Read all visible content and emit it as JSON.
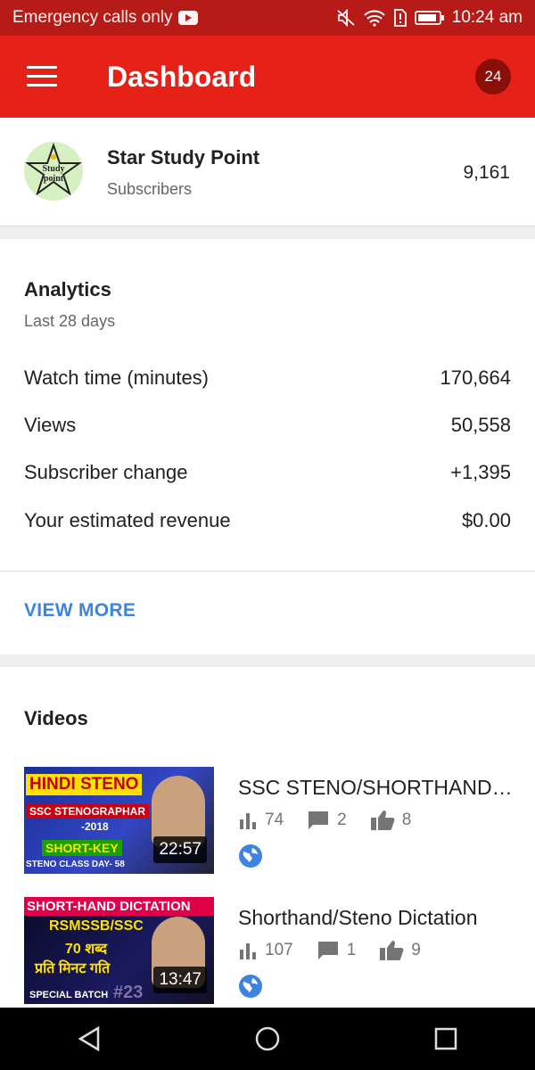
{
  "status_bar": {
    "carrier": "Emergency calls only",
    "time": "10:24 am"
  },
  "app_bar": {
    "title": "Dashboard",
    "notification_count": "24"
  },
  "channel": {
    "name": "Star Study Point",
    "avatar_text_1": "Study",
    "avatar_text_2": "point",
    "subscribers_label": "Subscribers",
    "subscribers_count": "9,161"
  },
  "analytics": {
    "title": "Analytics",
    "period": "Last 28 days",
    "metrics": [
      {
        "label": "Watch time (minutes)",
        "value": "170,664"
      },
      {
        "label": "Views",
        "value": "50,558"
      },
      {
        "label": "Subscriber change",
        "value": "+1,395"
      },
      {
        "label": "Your estimated revenue",
        "value": "$0.00"
      }
    ],
    "view_more": "VIEW MORE"
  },
  "videos": {
    "title": "Videos",
    "items": [
      {
        "title": "SSC STENO/SHORTHAND CLASS",
        "duration": "22:57",
        "views": "74",
        "comments": "2",
        "likes": "8",
        "thumb_lines": [
          "HINDI STENO",
          "SSC STENOGRAPHAR",
          "-2018",
          "SHORT-KEY",
          "STENO CLASS DAY- 58"
        ]
      },
      {
        "title": "Shorthand/Steno Dictation",
        "duration": "13:47",
        "views": "107",
        "comments": "1",
        "likes": "9",
        "thumb_lines": [
          "SHORT-HAND DICTATION",
          "RSMSSB/SSC",
          "70 शब्द",
          "प्रति मिनट गति",
          "SPECIAL BATCH",
          "#23"
        ]
      }
    ]
  },
  "colors": {
    "app_bar": "#e62117",
    "status_bar": "#b71b17",
    "accent_link": "#3d83e0"
  }
}
